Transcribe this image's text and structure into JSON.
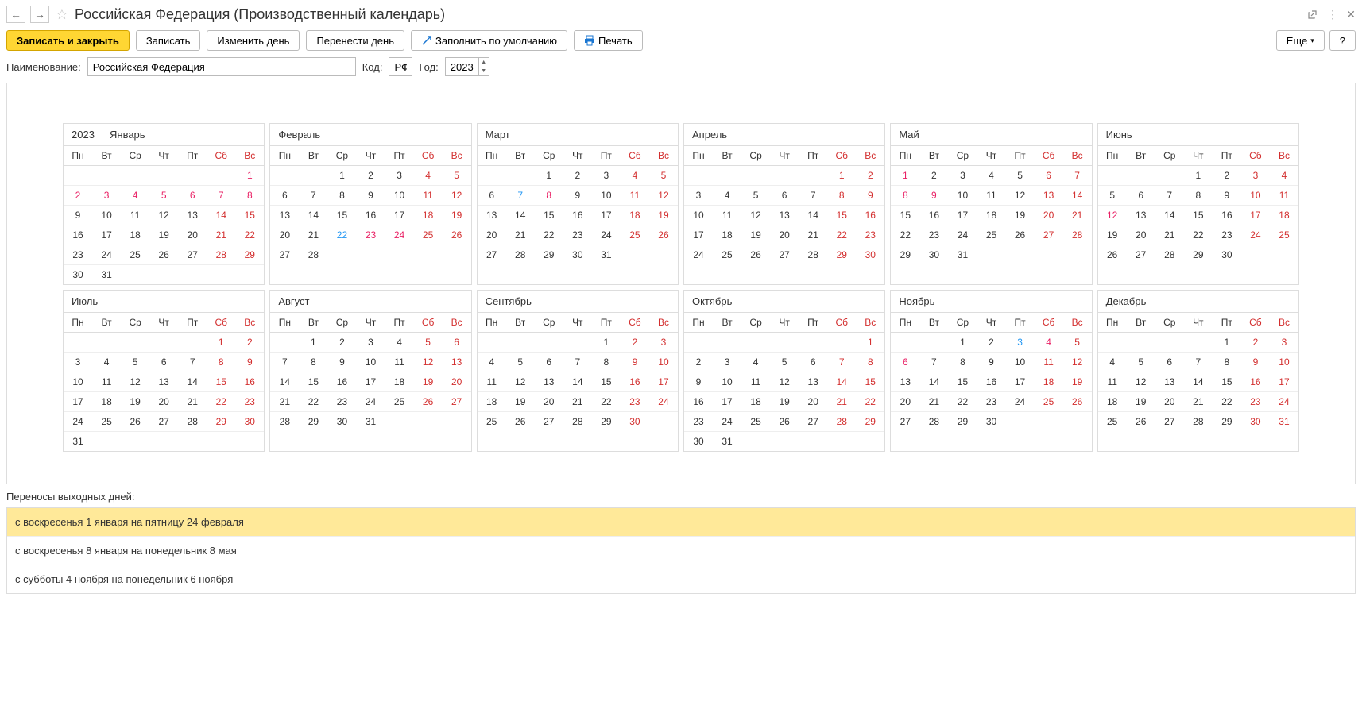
{
  "header": {
    "title": "Российская Федерация (Производственный календарь)"
  },
  "toolbar": {
    "save_close": "Записать и закрыть",
    "save": "Записать",
    "change_day": "Изменить день",
    "move_day": "Перенести день",
    "fill_default": "Заполнить по умолчанию",
    "print": "Печать",
    "more": "Еще",
    "help": "?"
  },
  "form": {
    "name_label": "Наименование:",
    "name_value": "Российская Федерация",
    "code_label": "Код:",
    "code_value": "РФ",
    "year_label": "Год:",
    "year_value": "2023"
  },
  "calendar": {
    "year": "2023",
    "dow": [
      "Пн",
      "Вт",
      "Ср",
      "Чт",
      "Пт",
      "Сб",
      "Вс"
    ],
    "months": [
      {
        "name": "Январь",
        "start": 6,
        "days": 31,
        "holiday": [
          1,
          2,
          3,
          4,
          5,
          6,
          7,
          8
        ],
        "preholiday": []
      },
      {
        "name": "Февраль",
        "start": 2,
        "days": 28,
        "holiday": [
          23,
          24
        ],
        "preholiday": [
          22
        ]
      },
      {
        "name": "Март",
        "start": 2,
        "days": 31,
        "holiday": [
          8
        ],
        "preholiday": [
          7
        ]
      },
      {
        "name": "Апрель",
        "start": 5,
        "days": 30,
        "holiday": [],
        "preholiday": []
      },
      {
        "name": "Май",
        "start": 0,
        "days": 31,
        "holiday": [
          1,
          8,
          9
        ],
        "preholiday": []
      },
      {
        "name": "Июнь",
        "start": 3,
        "days": 30,
        "holiday": [
          12
        ],
        "preholiday": []
      },
      {
        "name": "Июль",
        "start": 5,
        "days": 31,
        "holiday": [],
        "preholiday": []
      },
      {
        "name": "Август",
        "start": 1,
        "days": 31,
        "holiday": [],
        "preholiday": []
      },
      {
        "name": "Сентябрь",
        "start": 4,
        "days": 30,
        "holiday": [],
        "preholiday": []
      },
      {
        "name": "Октябрь",
        "start": 6,
        "days": 31,
        "holiday": [],
        "preholiday": []
      },
      {
        "name": "Ноябрь",
        "start": 2,
        "days": 30,
        "holiday": [
          4,
          6
        ],
        "preholiday": [
          3
        ]
      },
      {
        "name": "Декабрь",
        "start": 4,
        "days": 31,
        "holiday": [],
        "preholiday": []
      }
    ]
  },
  "transfers": {
    "label": "Переносы выходных дней:",
    "items": [
      "с воскресенья 1 января на пятницу 24 февраля",
      "с воскресенья 8 января на понедельник 8 мая",
      "с субботы 4 ноября на понедельник 6 ноября"
    ],
    "selected": 0
  }
}
